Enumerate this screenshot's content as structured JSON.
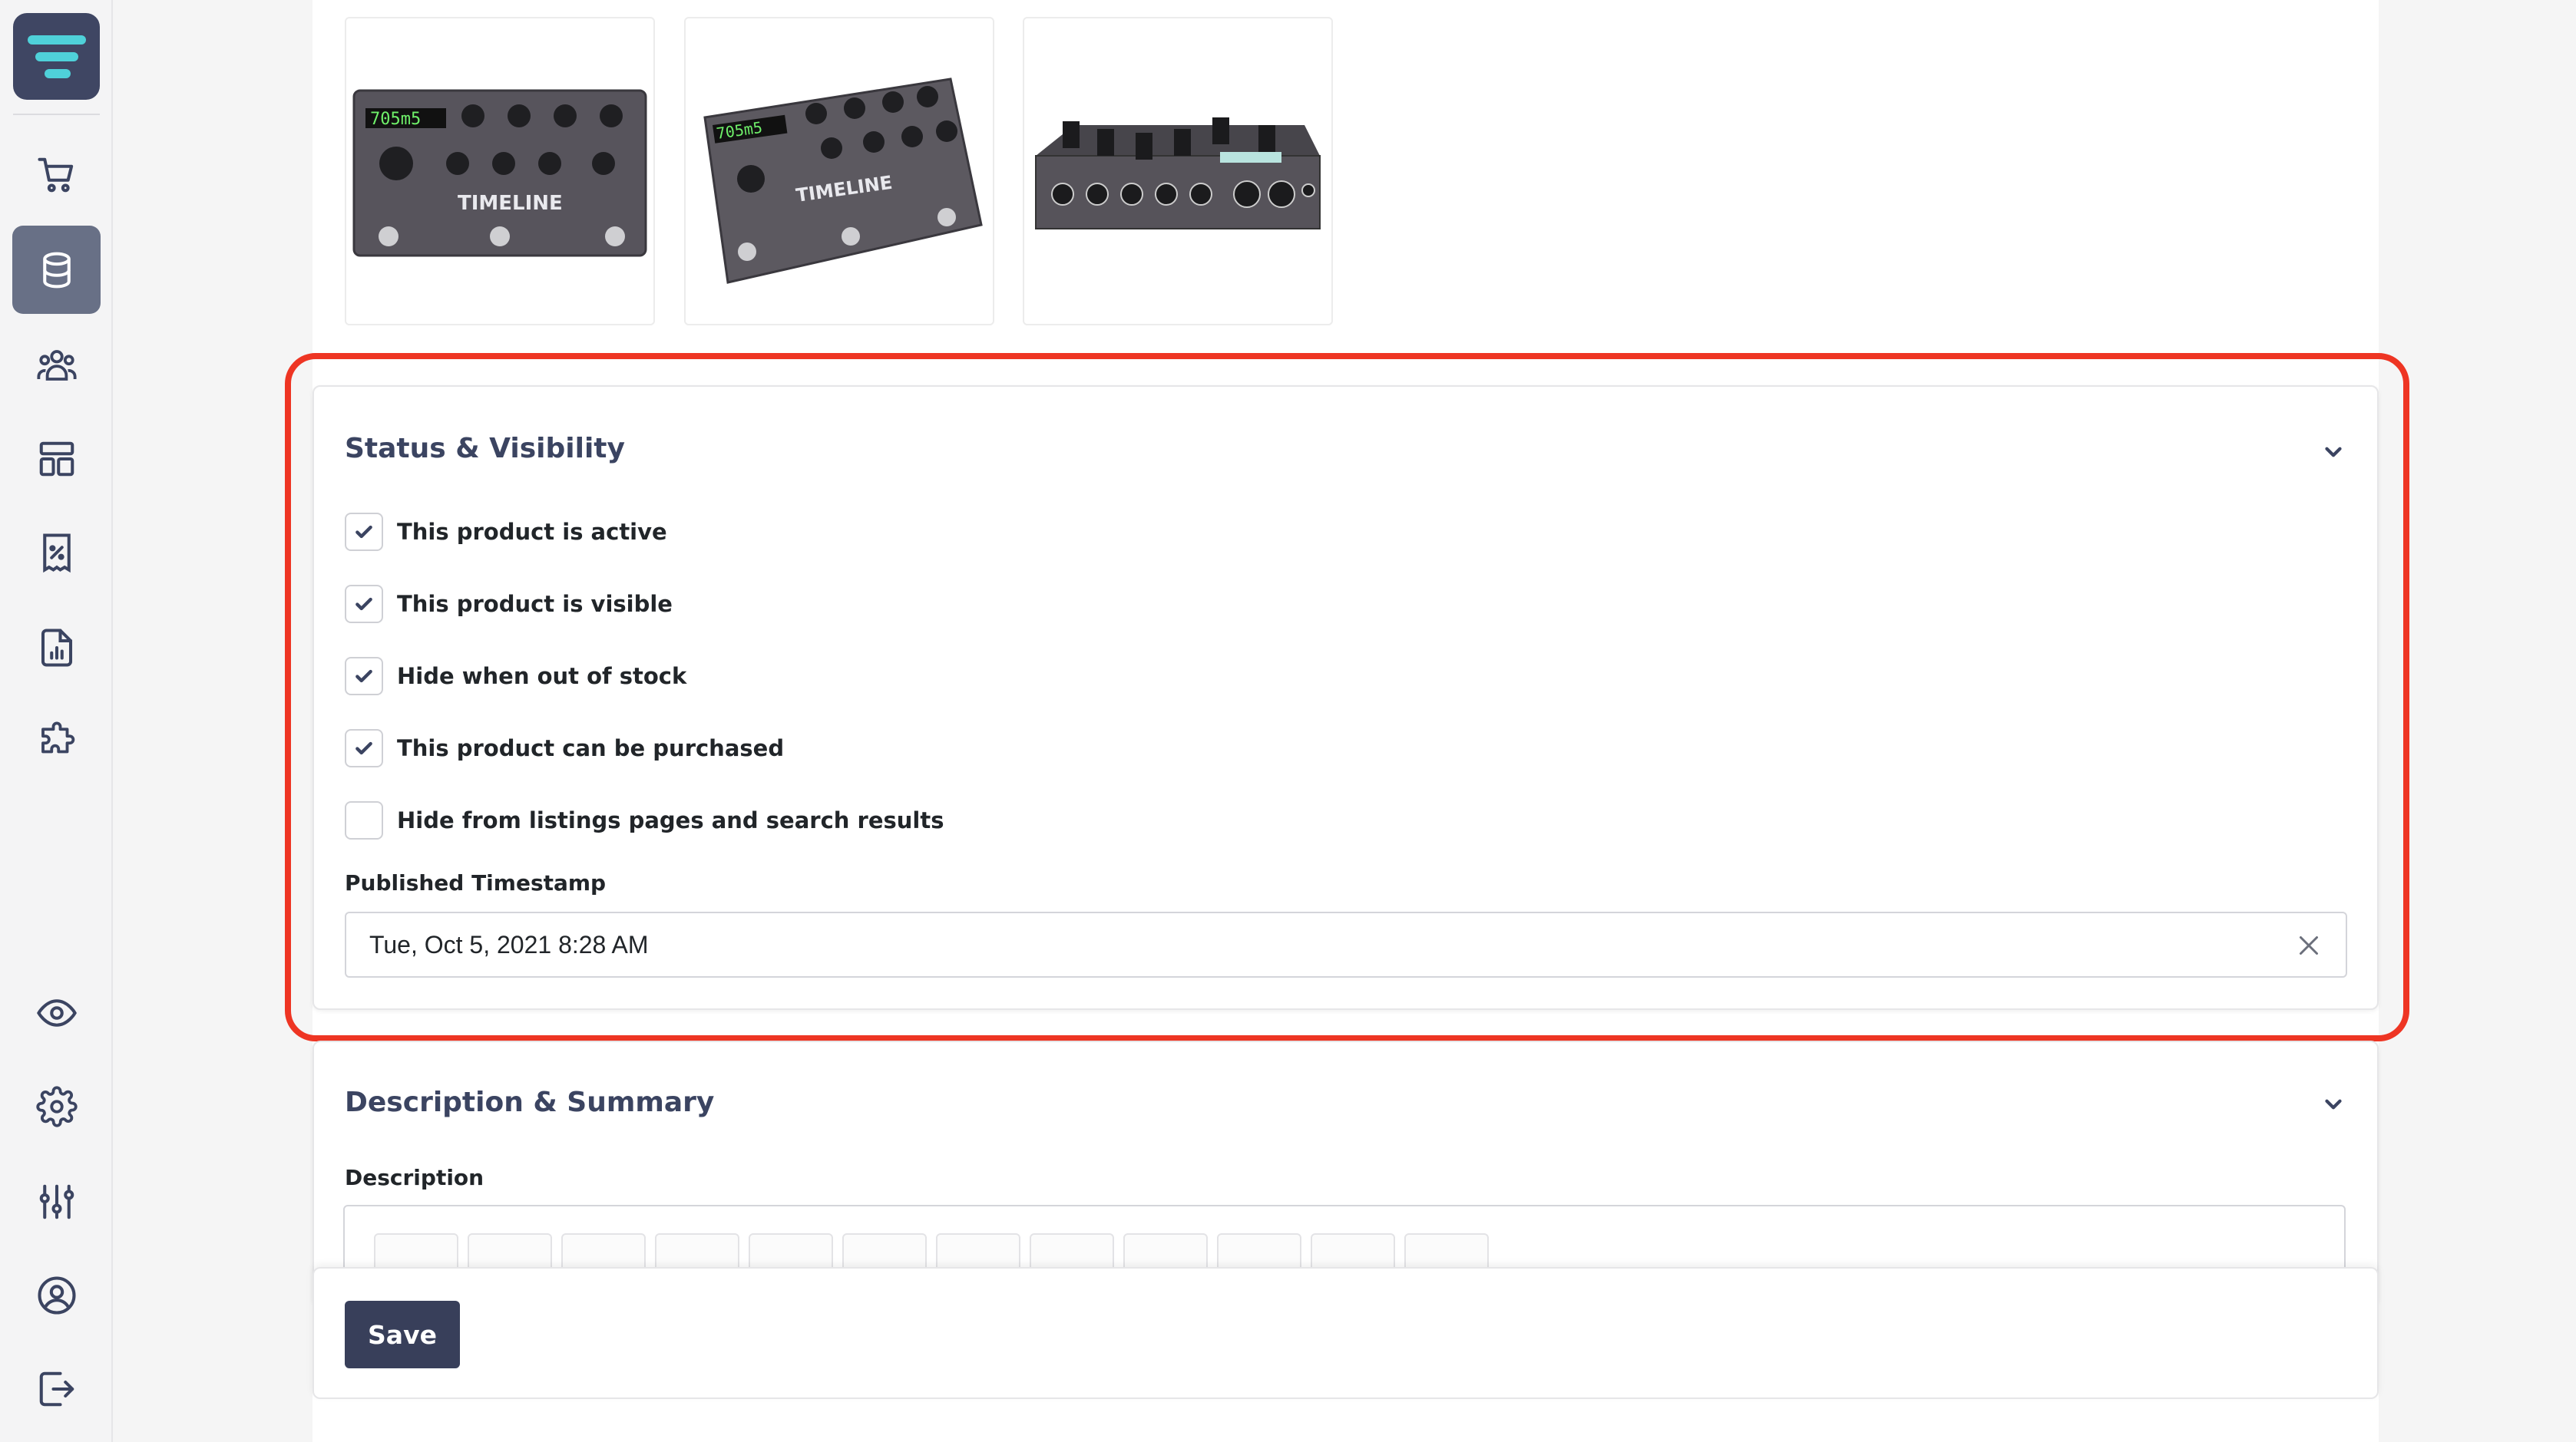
{
  "sidebar": {
    "logo_icon": "app-logo-icon",
    "items": [
      {
        "name": "cart-icon",
        "active": false
      },
      {
        "name": "database-icon",
        "active": true
      },
      {
        "name": "users-icon",
        "active": false
      },
      {
        "name": "layout-icon",
        "active": false
      },
      {
        "name": "discount-receipt-icon",
        "active": false
      },
      {
        "name": "report-icon",
        "active": false
      },
      {
        "name": "puzzle-icon",
        "active": false
      }
    ],
    "bottom_items": [
      {
        "name": "eye-icon"
      },
      {
        "name": "gear-icon"
      },
      {
        "name": "sliders-icon"
      },
      {
        "name": "account-icon"
      },
      {
        "name": "logout-icon"
      }
    ]
  },
  "images": [
    {
      "alt": "product-image-front"
    },
    {
      "alt": "product-image-angle"
    },
    {
      "alt": "product-image-back"
    }
  ],
  "status_visibility": {
    "title": "Status & Visibility",
    "checkboxes": [
      {
        "label": "This product is active",
        "checked": true
      },
      {
        "label": "This product is visible",
        "checked": true
      },
      {
        "label": "Hide when out of stock",
        "checked": true
      },
      {
        "label": "This product can be purchased",
        "checked": true
      },
      {
        "label": "Hide from listings pages and search results",
        "checked": false
      }
    ],
    "published_label": "Published Timestamp",
    "published_value": "Tue, Oct 5, 2021 8:28 AM"
  },
  "description_summary": {
    "title": "Description & Summary",
    "description_label": "Description"
  },
  "footer": {
    "save_label": "Save"
  },
  "colors": {
    "accent": "#383f5a",
    "highlight": "#ee3523",
    "logo_accent": "#4fd1d9"
  }
}
